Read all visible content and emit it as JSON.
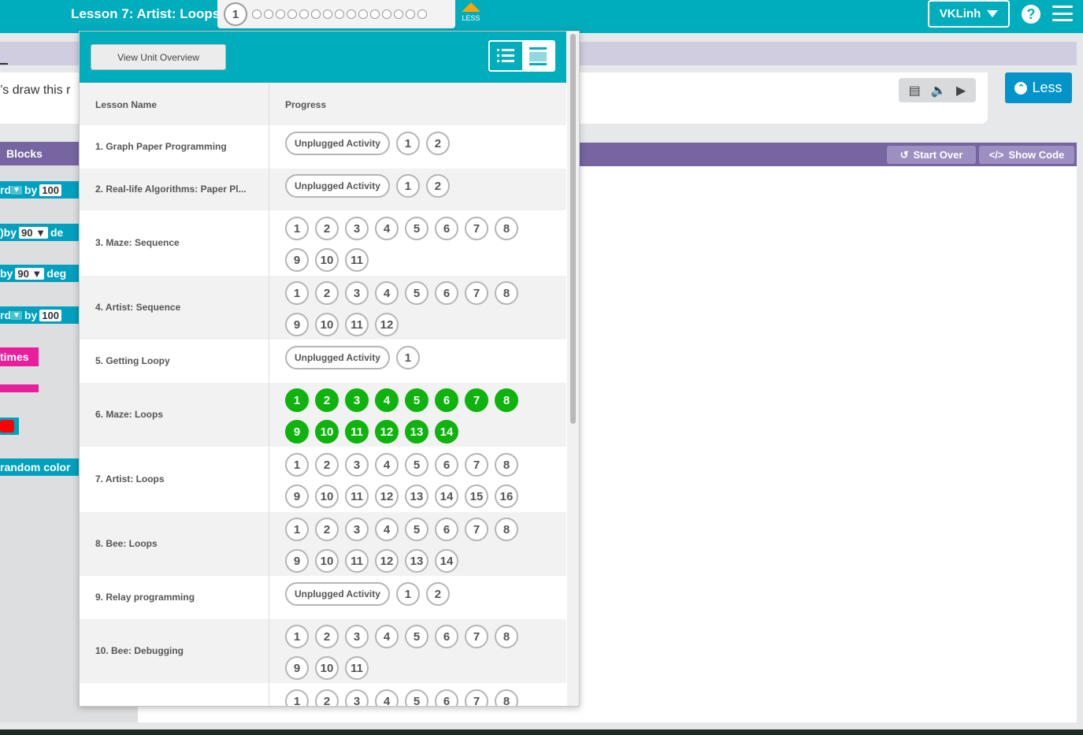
{
  "header": {
    "lesson_title": "Lesson 7: Artist: Loops",
    "current_level": "1",
    "level_dot_count": 15,
    "less_toggle_label": "LESS",
    "user_name": "VKLinh",
    "help_icon": "?"
  },
  "instructions": {
    "text": "’s draw this r",
    "less_button": "Less",
    "audio_icons": [
      "captions-icon",
      "speaker-icon",
      "play-icon"
    ]
  },
  "toolbox": {
    "header": "Blocks",
    "blocks": [
      {
        "prefix": "rd",
        "word": "by",
        "value": "100",
        "color": "#00a0be"
      },
      {
        "prefix": ")",
        "word": "by",
        "value": "90",
        "suffix": "de",
        "color": "#00a0be"
      },
      {
        "prefix": "by",
        "word": "",
        "value": "90",
        "suffix": "deg",
        "color": "#00a0be"
      },
      {
        "prefix": "rd",
        "word": "by",
        "value": "100",
        "color": "#00a0be"
      },
      {
        "prefix": "times",
        "color": "#e91e9c"
      },
      {
        "prefix": "",
        "color": "#e91e9c"
      },
      {
        "prefix": "",
        "color": "#00a0be"
      },
      {
        "prefix": "random color",
        "color": "#00a0be"
      }
    ]
  },
  "workspace": {
    "start_over": "Start Over",
    "show_code": "Show Code"
  },
  "dropdown": {
    "view_unit_overview": "View Unit Overview",
    "col_lesson_name": "Lesson Name",
    "col_progress": "Progress",
    "lessons": [
      {
        "name": "1. Graph Paper Programming",
        "unplugged": "Unplugged Activity",
        "levels": [
          "1",
          "2"
        ],
        "completed": 0
      },
      {
        "name": "2. Real-life Algorithms: Paper Pl...",
        "unplugged": "Unplugged Activity",
        "levels": [
          "1",
          "2"
        ],
        "completed": 0
      },
      {
        "name": "3. Maze: Sequence",
        "levels": [
          "1",
          "2",
          "3",
          "4",
          "5",
          "6",
          "7",
          "8",
          "9",
          "10",
          "11"
        ],
        "completed": 0
      },
      {
        "name": "4. Artist: Sequence",
        "levels": [
          "1",
          "2",
          "3",
          "4",
          "5",
          "6",
          "7",
          "8",
          "9",
          "10",
          "11",
          "12"
        ],
        "completed": 0
      },
      {
        "name": "5. Getting Loopy",
        "unplugged": "Unplugged Activity",
        "levels": [
          "1"
        ],
        "completed": 0
      },
      {
        "name": "6. Maze: Loops",
        "levels": [
          "1",
          "2",
          "3",
          "4",
          "5",
          "6",
          "7",
          "8",
          "9",
          "10",
          "11",
          "12",
          "13",
          "14"
        ],
        "completed": 14
      },
      {
        "name": "7. Artist: Loops",
        "levels": [
          "1",
          "2",
          "3",
          "4",
          "5",
          "6",
          "7",
          "8",
          "9",
          "10",
          "11",
          "12",
          "13",
          "14",
          "15",
          "16"
        ],
        "completed": 0
      },
      {
        "name": "8. Bee: Loops",
        "levels": [
          "1",
          "2",
          "3",
          "4",
          "5",
          "6",
          "7",
          "8",
          "9",
          "10",
          "11",
          "12",
          "13",
          "14"
        ],
        "completed": 0
      },
      {
        "name": "9. Relay programming",
        "unplugged": "Unplugged Activity",
        "levels": [
          "1",
          "2"
        ],
        "completed": 0
      },
      {
        "name": "10. Bee: Debugging",
        "levels": [
          "1",
          "2",
          "3",
          "4",
          "5",
          "6",
          "7",
          "8",
          "9",
          "10",
          "11"
        ],
        "completed": 0
      },
      {
        "name": "",
        "levels": [
          "1",
          "2",
          "3",
          "4",
          "5",
          "6",
          "7",
          "8"
        ],
        "completed": 0
      }
    ]
  },
  "colors": {
    "teal": "#00adbc",
    "purple": "#7665a0",
    "completed_green": "#0eb30e",
    "accent_orange": "#ffa400"
  }
}
